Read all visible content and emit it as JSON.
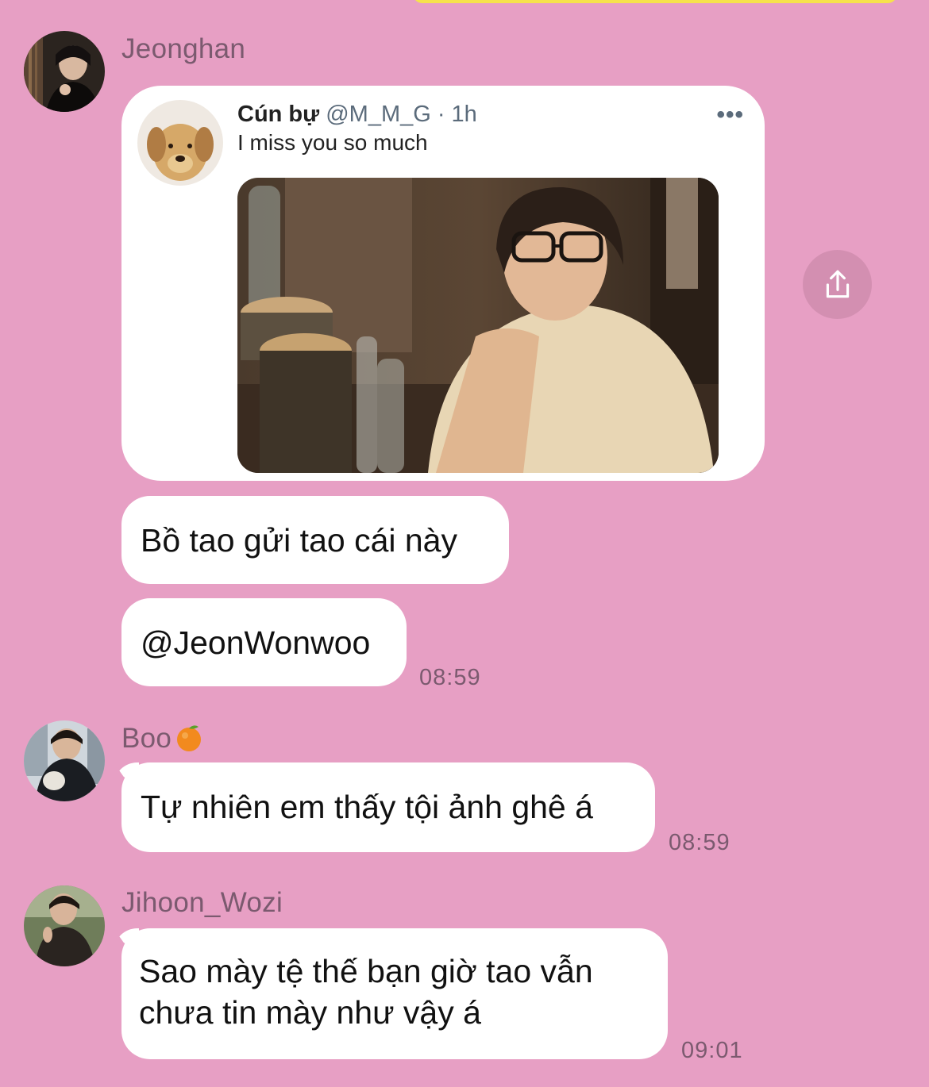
{
  "messages": [
    {
      "sender": "Jeonghan",
      "tweet": {
        "author": "Cún bự",
        "handle": "@M_M_G · 1h",
        "more": "•••",
        "text": "I miss you so much"
      },
      "bubbles": [
        "Bồ tao gửi tao cái này",
        "@JeonWonwoo"
      ],
      "time": "08:59"
    },
    {
      "sender": "Boo",
      "sender_emoji": "orange-emoji",
      "bubbles": [
        "Tự nhiên em thấy tội ảnh ghê á"
      ],
      "time": "08:59"
    },
    {
      "sender": "Jihoon_Wozi",
      "bubbles": [
        "Sao mày tệ thế bạn giờ tao vẫn",
        "chưa tin mày như vậy á"
      ],
      "time": "09:01"
    }
  ],
  "share_icon": "share-icon",
  "colors": {
    "background": "#e79fc4",
    "bubble": "#ffffff",
    "share_button": "#d38fb1",
    "meta_text": "#7b5a6f",
    "top_strip": "#f6e24c"
  }
}
